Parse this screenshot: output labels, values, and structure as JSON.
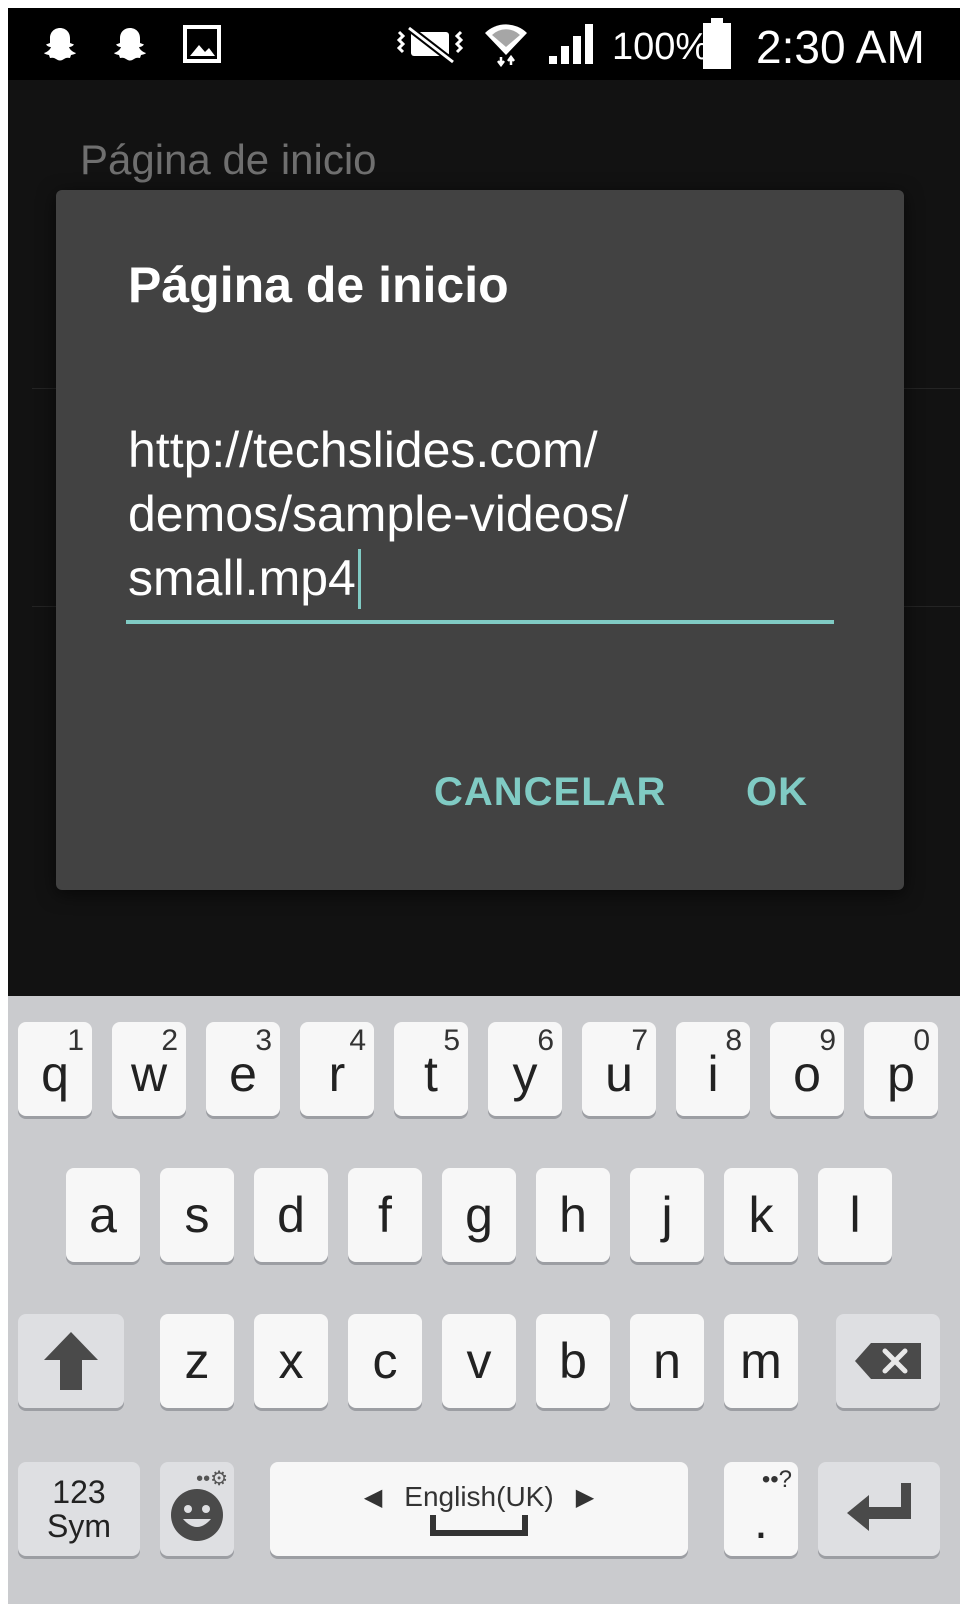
{
  "status_bar": {
    "battery": "100%",
    "time": "2:30 AM",
    "icons": [
      "snapchat-icon",
      "snapchat-icon",
      "gallery-icon",
      "vibrate-icon",
      "wifi-icon",
      "signal-icon",
      "battery-icon"
    ]
  },
  "background": {
    "title": "Página de inicio"
  },
  "dialog": {
    "title": "Página de inicio",
    "input_value": "http://techslides.com/\ndemos/sample-videos/\nsmall.mp4",
    "cancel_label": "CANCELAR",
    "ok_label": "OK",
    "accent_color": "#80cbc4"
  },
  "keyboard": {
    "row1": [
      {
        "key": "q",
        "hint": "1"
      },
      {
        "key": "w",
        "hint": "2"
      },
      {
        "key": "e",
        "hint": "3"
      },
      {
        "key": "r",
        "hint": "4"
      },
      {
        "key": "t",
        "hint": "5"
      },
      {
        "key": "y",
        "hint": "6"
      },
      {
        "key": "u",
        "hint": "7"
      },
      {
        "key": "i",
        "hint": "8"
      },
      {
        "key": "o",
        "hint": "9"
      },
      {
        "key": "p",
        "hint": "0"
      }
    ],
    "row2": [
      "a",
      "s",
      "d",
      "f",
      "g",
      "h",
      "j",
      "k",
      "l"
    ],
    "row3": [
      "z",
      "x",
      "c",
      "v",
      "b",
      "n",
      "m"
    ],
    "sym_line1": "123",
    "sym_line2": "Sym",
    "language": "English(UK)",
    "period_key": ".",
    "period_hint": "••?"
  }
}
